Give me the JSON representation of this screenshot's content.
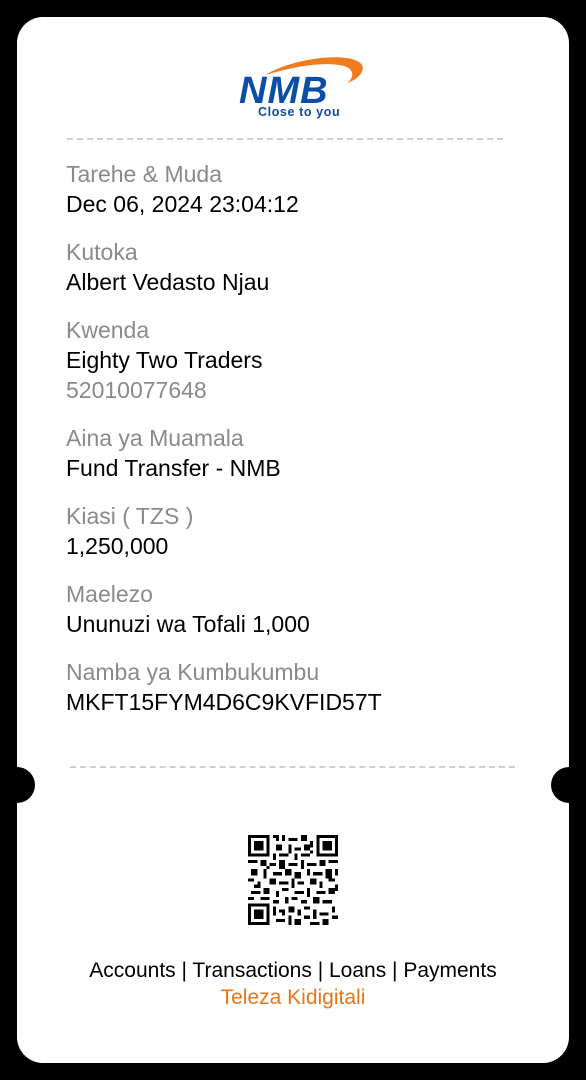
{
  "brand": {
    "name": "NMB",
    "tagline": "Close to you",
    "colors": {
      "blue": "#0a4ea8",
      "orange": "#f07c1d"
    }
  },
  "receipt": {
    "fields": [
      {
        "label": "Tarehe & Muda",
        "value": "Dec 06, 2024 23:04:12"
      },
      {
        "label": "Kutoka",
        "value": "Albert Vedasto Njau"
      },
      {
        "label": "Kwenda",
        "value": "Eighty Two Traders",
        "sub_value": "52010077648"
      },
      {
        "label": "Aina ya Muamala",
        "value": "Fund Transfer - NMB"
      },
      {
        "label": "Kiasi ( TZS )",
        "value": "1,250,000"
      },
      {
        "label": "Maelezo",
        "value": "Ununuzi wa Tofali 1,000"
      },
      {
        "label": "Namba ya Kumbukumbu",
        "value": "MKFT15FYM4D6C9KVFID57T"
      }
    ]
  },
  "footer": {
    "nav_text": "Accounts | Transactions | Loans | Payments",
    "tagline": "Teleza Kidigitali",
    "tagline_color": "#e8751a"
  },
  "icons": {
    "qr": "qr-code-icon"
  }
}
